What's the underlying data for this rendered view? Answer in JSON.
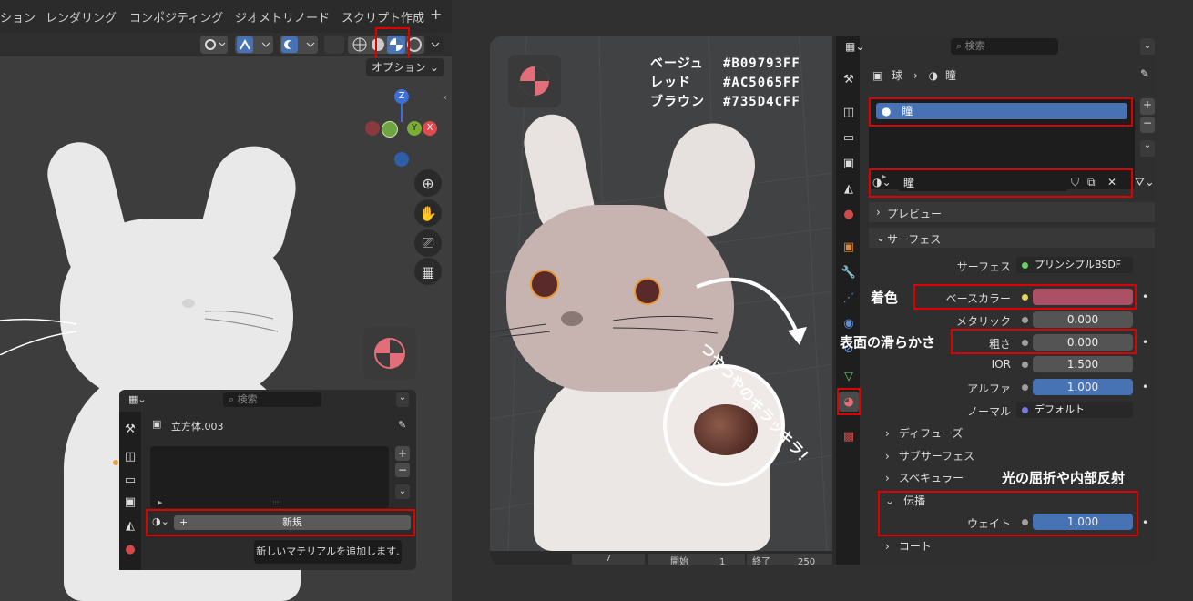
{
  "left_viewport": {
    "workspace_tabs": [
      "ション",
      "レンダリング",
      "コンポジティング",
      "ジオメトリノード",
      "スクリプト作成"
    ],
    "add_tab_label": "+",
    "options_label": "オプション",
    "gizmo_labels": {
      "z": "Z",
      "y": "Y",
      "x": "X"
    }
  },
  "small_panel": {
    "search_placeholder": "検索",
    "object_name": "立方体.003",
    "new_button_label": "新規",
    "tooltip": "新しいマテリアルを追加します.",
    "plus_label": "+",
    "minus_label": "−"
  },
  "hex_legend": [
    {
      "name": "ベージュ",
      "hex": "#B09793FF"
    },
    {
      "name": "レッド",
      "hex": "#AC5065FF"
    },
    {
      "name": "ブラウン",
      "hex": "#735D4CFF"
    }
  ],
  "annotations": {
    "shiny": "つやつやのキラッキラ！",
    "base_color": "着色",
    "smoothness": "表面の滑らかさ",
    "refraction": "光の屈折や内部反射"
  },
  "properties": {
    "search_placeholder": "検索",
    "breadcrumb": {
      "object": "球",
      "material": "瞳"
    },
    "slot_name": "瞳",
    "material_name": "瞳",
    "sections": {
      "preview": "プレビュー",
      "surface": "サーフェス"
    },
    "surface_label": "サーフェス",
    "surface_value": "プリンシプルBSDF",
    "rows": [
      {
        "label": "ベースカラー",
        "value": ""
      },
      {
        "label": "メタリック",
        "value": "0.000"
      },
      {
        "label": "粗さ",
        "value": "0.000"
      },
      {
        "label": "IOR",
        "value": "1.500"
      },
      {
        "label": "アルファ",
        "value": "1.000"
      },
      {
        "label": "ノーマル",
        "value": "デフォルト"
      }
    ],
    "subsections": [
      "ディフューズ",
      "サブサーフェス",
      "スペキュラー"
    ],
    "transmission_label": "伝播",
    "weight_label": "ウェイト",
    "weight_value": "1.000",
    "coat_label": "コート"
  },
  "timeline": {
    "start_label": "開始",
    "start_value": "1",
    "end_label": "終了",
    "end_value": "250",
    "current": "7"
  },
  "colors": {
    "base_color": "#AC5065",
    "accent_blue": "#4772b3",
    "highlight_red": "#e00000"
  }
}
